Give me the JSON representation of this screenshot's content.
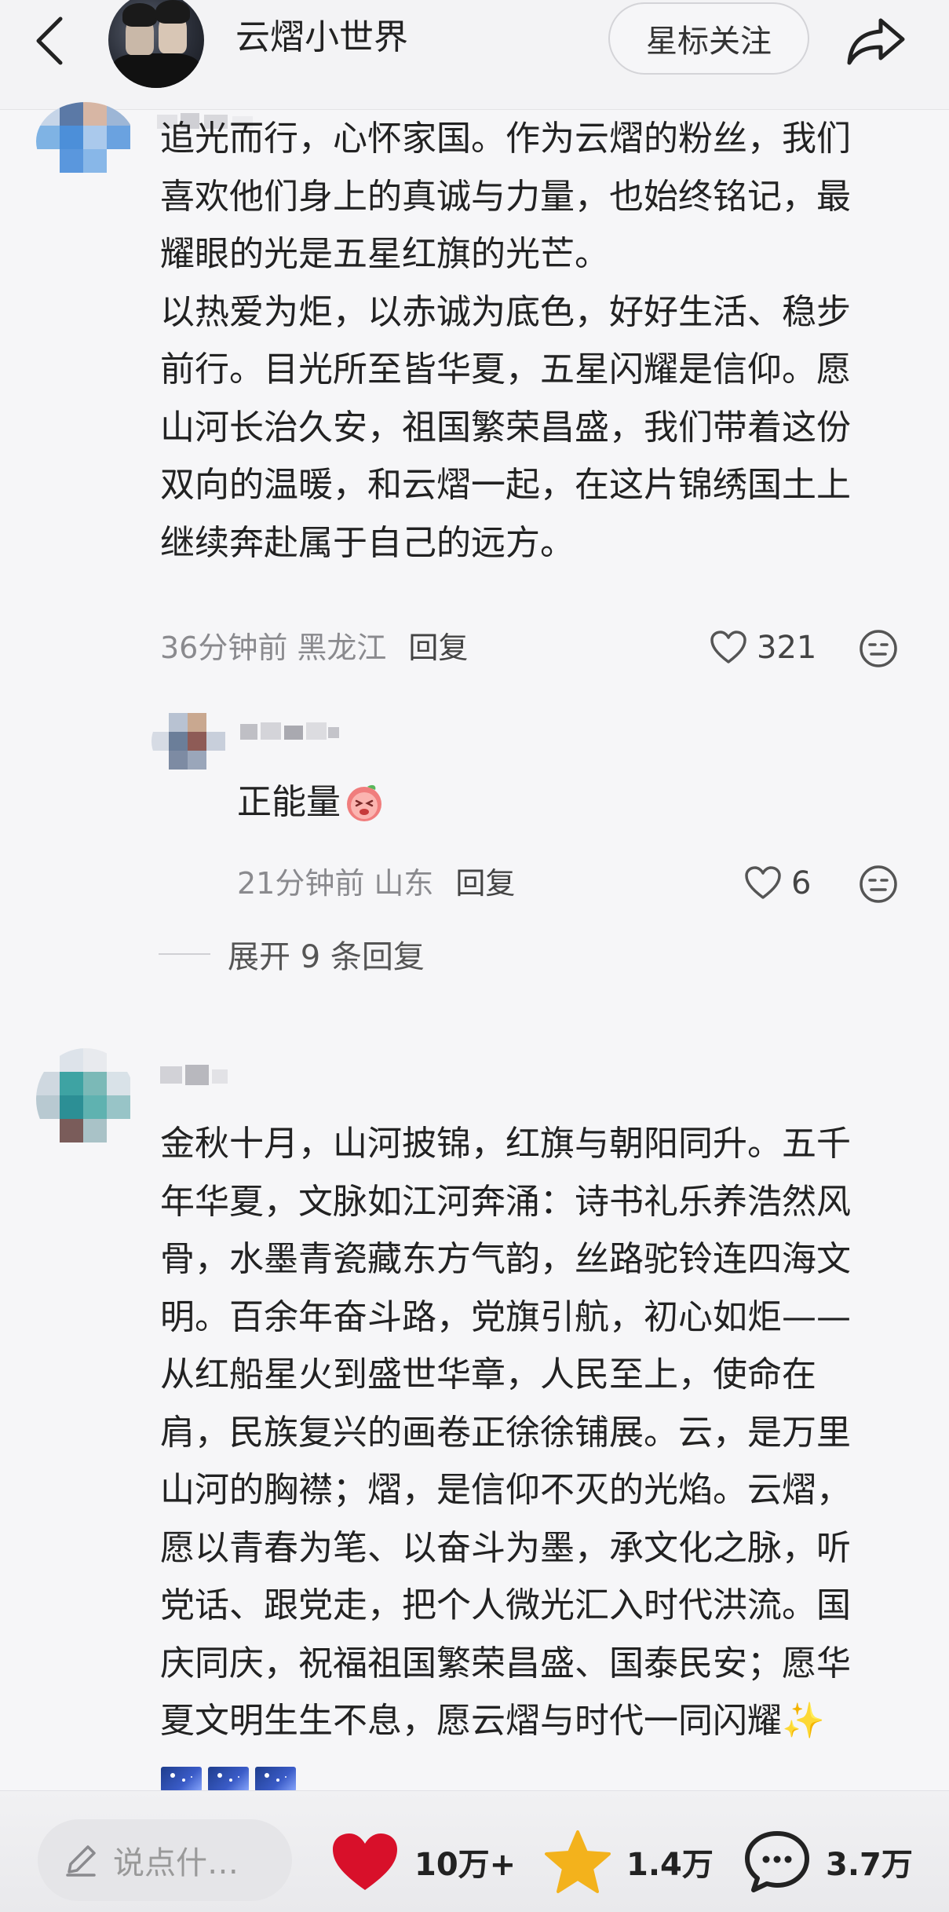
{
  "header": {
    "title": "云熠小世界",
    "follow_label": "星标关注"
  },
  "comments": [
    {
      "text": "追光而行，心怀家国。作为云熠的粉丝，我们\n喜欢他们身上的真诚与力量，也始终铭记，最\n耀眼的光是五星红旗的光芒。\n以热爱为炬，以赤诚为底色，好好生活、稳步\n前行。目光所至皆华夏，五星闪耀是信仰。愿\n山河长治久安，祖国繁荣昌盛，我们带着这份\n双向的温暖，和云熠一起，在这片锦绣国土上\n继续奔赴属于自己的远方。",
      "time": "36分钟前",
      "location": "黑龙江",
      "reply_label": "回复",
      "likes": "321"
    },
    {
      "text": "正能量",
      "time": "21分钟前",
      "location": "山东",
      "reply_label": "回复",
      "likes": "6"
    },
    {
      "text": "金秋十月，山河披锦，红旗与朝阳同升。五千\n年华夏，文脉如江河奔涌：诗书礼乐养浩然风\n骨，水墨青瓷藏东方气韵，丝路驼铃连四海文\n明。百余年奋斗路，党旗引航，初心如炬——\n从红船星火到盛世华章，人民至上，使命在\n肩，民族复兴的画卷正徐徐铺展。云，是万里\n山河的胸襟；熠，是信仰不灭的光焰。云熠，\n愿以青春为笔、以奋斗为墨，承文化之脉，听\n党话、跟党走，把个人微光汇入时代洪流。国\n庆同庆，祝福祖国繁荣昌盛、国泰民安；愿华\n夏文明生生不息，愿云熠与时代一同闪耀✨"
    }
  ],
  "expand_label": "展开 9 条回复",
  "bottom_bar": {
    "input_placeholder": "说点什…",
    "likes": "10万+",
    "favorites": "1.4万",
    "comments": "3.7万"
  },
  "colors": {
    "like_red": "#d8102a",
    "star_gold": "#f3b21c",
    "text_dark": "#222222",
    "meta_gray": "#8a8a8e"
  },
  "icons": [
    "back-arrow-icon",
    "share-icon",
    "heart-outline-icon",
    "face-icon",
    "pencil-icon",
    "heart-filled-icon",
    "star-icon",
    "chat-bubble-icon"
  ]
}
